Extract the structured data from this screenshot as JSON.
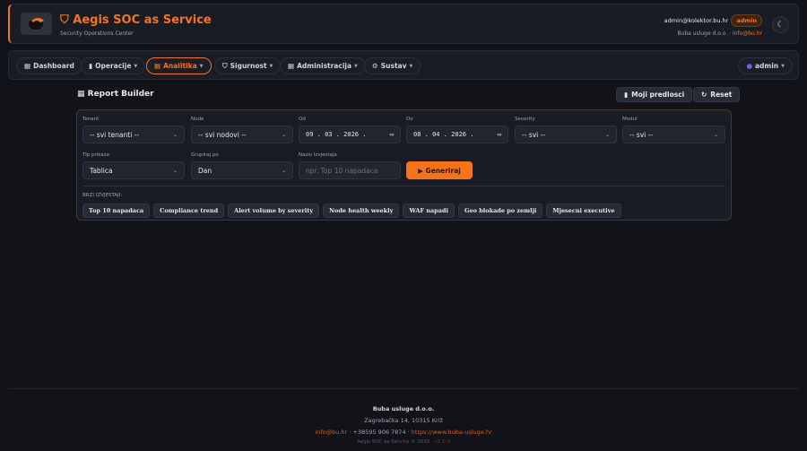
{
  "header": {
    "title": "Aegis SOC as Service",
    "subtitle": "Security Operations Center",
    "user_email": "admin@kolektor.bu.hr",
    "role_badge": "admin",
    "company": "Buba usluge d.o.o.",
    "company_sep": " · ",
    "company_email": "info@bu.hr",
    "theme_icon": "moon-icon"
  },
  "nav": {
    "items": [
      {
        "label": "Dashboard",
        "icon": "▦"
      },
      {
        "label": "Operacije",
        "icon": "▮"
      },
      {
        "label": "Analitika",
        "icon": "▦"
      },
      {
        "label": "Sigurnost",
        "icon": "⛉"
      },
      {
        "label": "Administracija",
        "icon": "▦"
      },
      {
        "label": "Sustav",
        "icon": "⚙"
      }
    ],
    "active": "Analitika",
    "user": "admin"
  },
  "page": {
    "title": "Report Builder",
    "templates_button": "Moji predlosci",
    "reset_button": "Reset"
  },
  "form": {
    "tenant": {
      "label": "Tenant",
      "value": "-- svi tenanti --"
    },
    "node": {
      "label": "Node",
      "value": "-- svi nodovi --"
    },
    "od": {
      "label": "Od",
      "value": "09 . 03 . 2026 ."
    },
    "do": {
      "label": "Do",
      "value": "08 . 04 . 2026 ."
    },
    "severity": {
      "label": "Severity",
      "value": "-- svi --"
    },
    "modul": {
      "label": "Modul",
      "value": "-- svi --"
    },
    "tip": {
      "label": "Tip prikaza",
      "value": "Tablica"
    },
    "grupiraj": {
      "label": "Grupiraj po",
      "value": "Dan"
    },
    "naziv": {
      "label": "Naziv izvjestaja",
      "placeholder": "npr. Top 10 napadaca",
      "value": ""
    },
    "generate_button": "▶ Generiraj"
  },
  "quick": {
    "label": "BRZI IZVJESTAJI:",
    "items": [
      "Top 10 napadaca",
      "Compliance trend",
      "Alert volume by severity",
      "Node health weekly",
      "WAF napadi",
      "Geo blokade po zemlji",
      "Mjesecni executive"
    ]
  },
  "footer": {
    "company": "Buba usluge d.o.o.",
    "address": "Zagrebačka 14, 10315 Križ",
    "email": "info@bu.hr",
    "phone": " · +38595 906 7874 · ",
    "website": "https://www.buba-usluge.hr",
    "copyright": "Aegis SOC as Service © 2026 · ",
    "version": "v1.0.0"
  },
  "colors": {
    "accent": "#f97316",
    "background": "#111318",
    "panel": "#181c24"
  }
}
